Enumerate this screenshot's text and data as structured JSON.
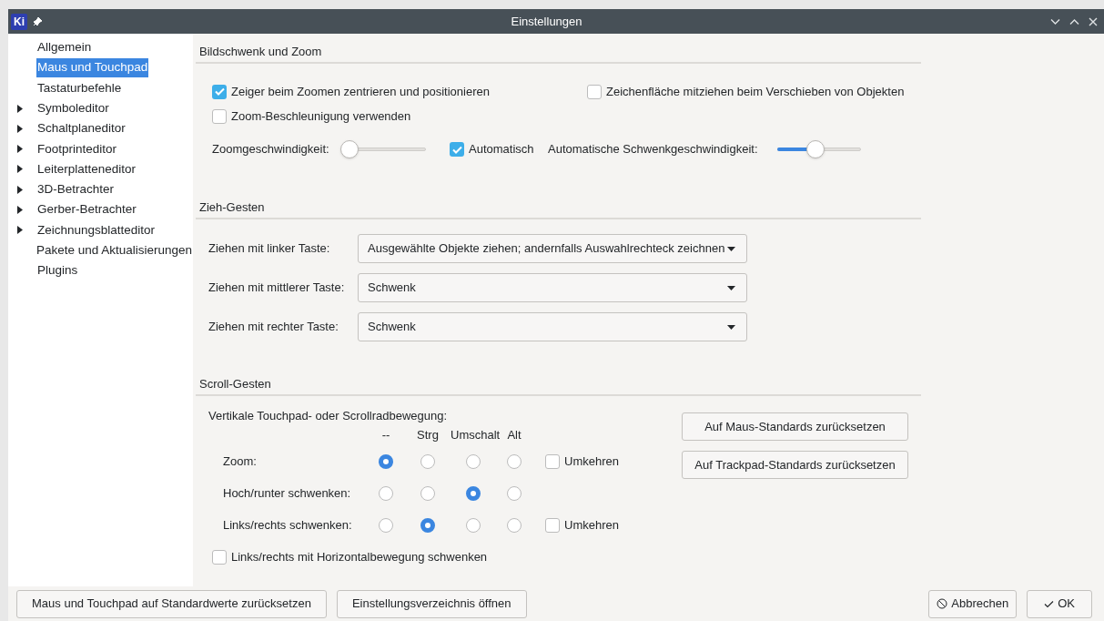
{
  "window": {
    "app_badge": "Ki",
    "title": "Einstellungen"
  },
  "sidebar": {
    "items": [
      {
        "label": "Allgemein",
        "selected": false,
        "kind": "page"
      },
      {
        "label": "Maus und Touchpad",
        "selected": true,
        "kind": "page"
      },
      {
        "label": "Tastaturbefehle",
        "selected": false,
        "kind": "page"
      },
      {
        "label": "Symboleditor",
        "selected": false,
        "kind": "group"
      },
      {
        "label": "Schaltplaneditor",
        "selected": false,
        "kind": "group"
      },
      {
        "label": "Footprinteditor",
        "selected": false,
        "kind": "group"
      },
      {
        "label": "Leiterplatteneditor",
        "selected": false,
        "kind": "group"
      },
      {
        "label": "3D-Betrachter",
        "selected": false,
        "kind": "group"
      },
      {
        "label": "Gerber-Betrachter",
        "selected": false,
        "kind": "group"
      },
      {
        "label": "Zeichnungsblatteditor",
        "selected": false,
        "kind": "group"
      },
      {
        "label": "Pakete und Aktualisierungen",
        "selected": false,
        "kind": "page"
      },
      {
        "label": "Plugins",
        "selected": false,
        "kind": "page"
      }
    ]
  },
  "pan_zoom": {
    "title": "Bildschwenk und Zoom",
    "center_pointer": {
      "label": "Zeiger beim Zoomen zentrieren und positionieren",
      "checked": true
    },
    "drag_canvas": {
      "label": "Zeichenfläche mitziehen beim Verschieben von Objekten",
      "checked": false
    },
    "zoom_accel": {
      "label": "Zoom-Beschleunigung verwenden",
      "checked": false
    },
    "zoom_speed": {
      "label": "Zoomgeschwindigkeit:",
      "level": 0.0
    },
    "auto": {
      "label": "Automatisch",
      "checked": true
    },
    "pan_speed": {
      "label": "Automatische Schwenkgeschwindigkeit:",
      "level": 0.45
    }
  },
  "drag_gestures": {
    "title": "Zieh-Gesten",
    "rows": [
      {
        "label": "Ziehen mit linker Taste:",
        "value": "Ausgewählte Objekte ziehen; andernfalls Auswahlrechteck zeichnen"
      },
      {
        "label": "Ziehen mit mittlerer Taste:",
        "value": "Schwenk"
      },
      {
        "label": "Ziehen mit rechter Taste:",
        "value": "Schwenk"
      }
    ]
  },
  "scroll_gestures": {
    "title": "Scroll-Gesten",
    "subtitle": "Vertikale Touchpad- oder Scrollradbewegung:",
    "columns": [
      "--",
      "Strg",
      "Umschalt",
      "Alt"
    ],
    "rows": [
      {
        "label": "Zoom:",
        "choices": [
          {
            "selected": true
          },
          {
            "selected": false
          },
          {
            "selected": false
          },
          {
            "selected": false
          }
        ],
        "reverse": {
          "label": "Umkehren",
          "checked": false
        }
      },
      {
        "label": "Hoch/runter schwenken:",
        "choices": [
          {
            "selected": false
          },
          {
            "selected": false
          },
          {
            "selected": true
          },
          {
            "selected": false
          }
        ]
      },
      {
        "label": "Links/rechts schwenken:",
        "choices": [
          {
            "selected": false
          },
          {
            "selected": true
          },
          {
            "selected": false
          },
          {
            "selected": false
          }
        ],
        "reverse": {
          "label": "Umkehren",
          "checked": false
        }
      }
    ],
    "horizontal": {
      "label": "Links/rechts mit Horizontalbewegung schwenken",
      "checked": false
    },
    "buttons": [
      "Auf Maus-Standards zurücksetzen",
      "Auf Trackpad-Standards zurücksetzen"
    ]
  },
  "footer": {
    "left_buttons": [
      "Maus und Touchpad auf Standardwerte zurücksetzen",
      "Einstellungsverzeichnis öffnen"
    ],
    "cancel": "Abbrechen",
    "ok": "OK"
  }
}
